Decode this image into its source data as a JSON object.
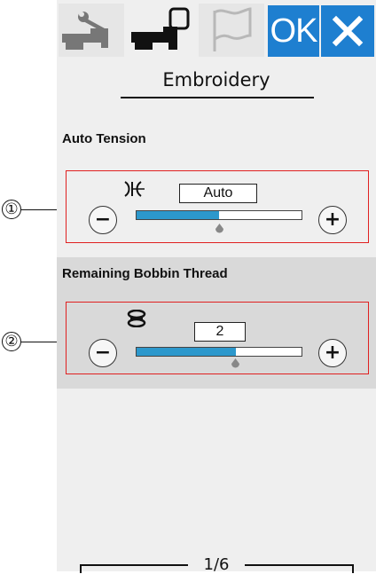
{
  "tabs": {
    "ok_label": "OK",
    "items": [
      {
        "icon": "wrench-machine-icon"
      },
      {
        "icon": "embroidery-machine-icon",
        "selected": true
      },
      {
        "icon": "flag-icon"
      }
    ],
    "close_icon": "close-icon"
  },
  "page": {
    "title": "Embroidery"
  },
  "auto_tension": {
    "label": "Auto Tension",
    "callout": "①",
    "icon": "tension-icon",
    "value": "Auto",
    "minus": "−",
    "plus": "+",
    "level": 0.5
  },
  "bobbin": {
    "label": "Remaining Bobbin Thread",
    "callout": "②",
    "icon": "bobbin-icon",
    "value": "2",
    "minus": "−",
    "plus": "+",
    "level": 0.6
  },
  "pager": {
    "text": "1/6"
  },
  "colors": {
    "accent": "#1e7fd0",
    "slider_fill": "#2c98cc",
    "highlight_border": "#e02020",
    "band": "#d9d9d9"
  }
}
